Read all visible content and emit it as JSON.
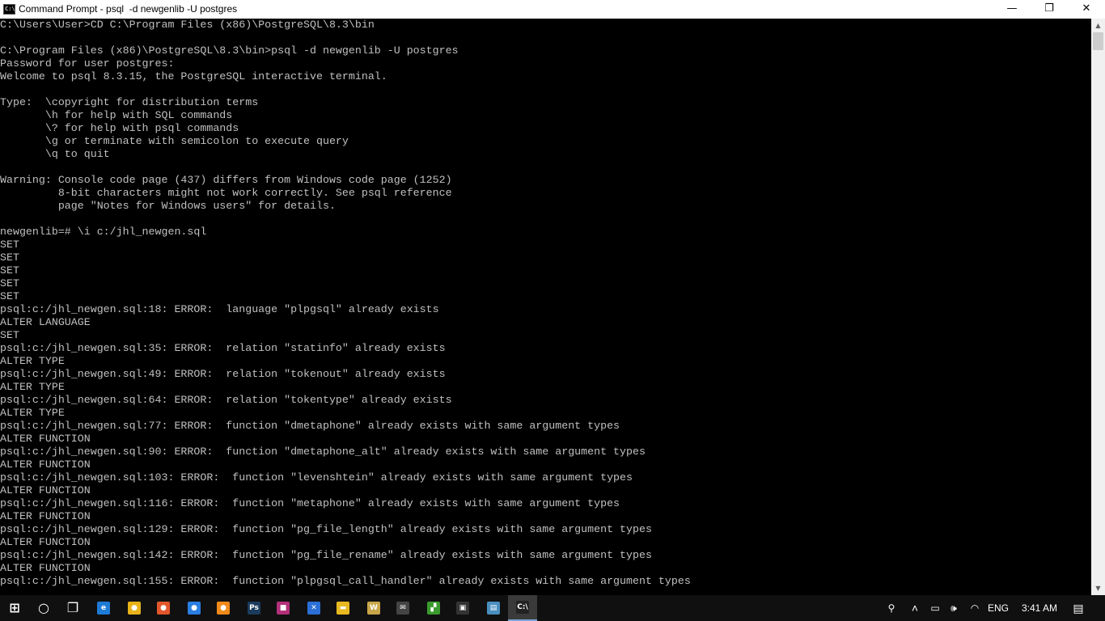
{
  "window": {
    "title": "Command Prompt - psql  -d newgenlib -U postgres",
    "icon_label": "C:\\"
  },
  "controls": {
    "minimize": "—",
    "maximize": "❐",
    "close": "✕"
  },
  "console": {
    "lines": [
      "C:\\Users\\User>CD C:\\Program Files (x86)\\PostgreSQL\\8.3\\bin",
      "",
      "C:\\Program Files (x86)\\PostgreSQL\\8.3\\bin>psql -d newgenlib -U postgres",
      "Password for user postgres:",
      "Welcome to psql 8.3.15, the PostgreSQL interactive terminal.",
      "",
      "Type:  \\copyright for distribution terms",
      "       \\h for help with SQL commands",
      "       \\? for help with psql commands",
      "       \\g or terminate with semicolon to execute query",
      "       \\q to quit",
      "",
      "Warning: Console code page (437) differs from Windows code page (1252)",
      "         8-bit characters might not work correctly. See psql reference",
      "         page \"Notes for Windows users\" for details.",
      "",
      "newgenlib=# \\i c:/jhl_newgen.sql",
      "SET",
      "SET",
      "SET",
      "SET",
      "SET",
      "psql:c:/jhl_newgen.sql:18: ERROR:  language \"plpgsql\" already exists",
      "ALTER LANGUAGE",
      "SET",
      "psql:c:/jhl_newgen.sql:35: ERROR:  relation \"statinfo\" already exists",
      "ALTER TYPE",
      "psql:c:/jhl_newgen.sql:49: ERROR:  relation \"tokenout\" already exists",
      "ALTER TYPE",
      "psql:c:/jhl_newgen.sql:64: ERROR:  relation \"tokentype\" already exists",
      "ALTER TYPE",
      "psql:c:/jhl_newgen.sql:77: ERROR:  function \"dmetaphone\" already exists with same argument types",
      "ALTER FUNCTION",
      "psql:c:/jhl_newgen.sql:90: ERROR:  function \"dmetaphone_alt\" already exists with same argument types",
      "ALTER FUNCTION",
      "psql:c:/jhl_newgen.sql:103: ERROR:  function \"levenshtein\" already exists with same argument types",
      "ALTER FUNCTION",
      "psql:c:/jhl_newgen.sql:116: ERROR:  function \"metaphone\" already exists with same argument types",
      "ALTER FUNCTION",
      "psql:c:/jhl_newgen.sql:129: ERROR:  function \"pg_file_length\" already exists with same argument types",
      "ALTER FUNCTION",
      "psql:c:/jhl_newgen.sql:142: ERROR:  function \"pg_file_rename\" already exists with same argument types",
      "ALTER FUNCTION",
      "psql:c:/jhl_newgen.sql:155: ERROR:  function \"plpgsql_call_handler\" already exists with same argument types"
    ]
  },
  "scrollbar": {
    "up_arrow": "▲",
    "down_arrow": "▼"
  },
  "taskbar": {
    "apps": [
      {
        "name": "start-button",
        "icon": "windows-icon",
        "glyph": "⊞",
        "color": "#ffffff"
      },
      {
        "name": "cortana-button",
        "icon": "cortana-icon",
        "glyph": "○",
        "color": "#ffffff"
      },
      {
        "name": "task-view-button",
        "icon": "task-view-icon",
        "glyph": "❐",
        "color": "#ffffff"
      },
      {
        "name": "edge-app",
        "icon": "edge-icon",
        "glyph": "e",
        "color": "#1e7bd6"
      },
      {
        "name": "chrome-app",
        "icon": "chrome-icon",
        "glyph": "●",
        "color": "#e8b31a"
      },
      {
        "name": "firefox-app-1",
        "icon": "firefox-icon",
        "glyph": "●",
        "color": "#e3562b"
      },
      {
        "name": "firefox-app-2",
        "icon": "firefox-icon",
        "glyph": "●",
        "color": "#2a7fe0"
      },
      {
        "name": "firefox-app-3",
        "icon": "firefox-icon",
        "glyph": "●",
        "color": "#f08a1a"
      },
      {
        "name": "photoshop-app",
        "icon": "photoshop-icon",
        "glyph": "Ps",
        "color": "#1a3b5c"
      },
      {
        "name": "app-magenta",
        "icon": "app-icon",
        "glyph": "■",
        "color": "#b2307a"
      },
      {
        "name": "app-blue-x",
        "icon": "x-app-icon",
        "glyph": "✕",
        "color": "#2b6fd6"
      },
      {
        "name": "file-explorer-app",
        "icon": "folder-icon",
        "glyph": "▬",
        "color": "#e8b820"
      },
      {
        "name": "word-app",
        "icon": "word-icon",
        "glyph": "W",
        "color": "#c9a64a"
      },
      {
        "name": "mail-app",
        "icon": "mail-icon",
        "glyph": "✉",
        "color": "#444444"
      },
      {
        "name": "app-green",
        "icon": "app-icon",
        "glyph": "▞",
        "color": "#3b9a2e"
      },
      {
        "name": "sticky-notes-app",
        "icon": "sticky-notes-icon",
        "glyph": "▣",
        "color": "#333333"
      },
      {
        "name": "notepad-app",
        "icon": "notepad-icon",
        "glyph": "▤",
        "color": "#4a8fbf"
      },
      {
        "name": "command-prompt-app",
        "icon": "cmd-icon",
        "glyph": "C:\\",
        "color": "#222222",
        "active": true
      }
    ],
    "tray": {
      "people": "⚲",
      "chevron": "˄",
      "battery": "▭",
      "volume": "🕪",
      "wifi": "◠",
      "language": "ENG",
      "time": "3:41 AM",
      "notifications": "▤"
    }
  }
}
